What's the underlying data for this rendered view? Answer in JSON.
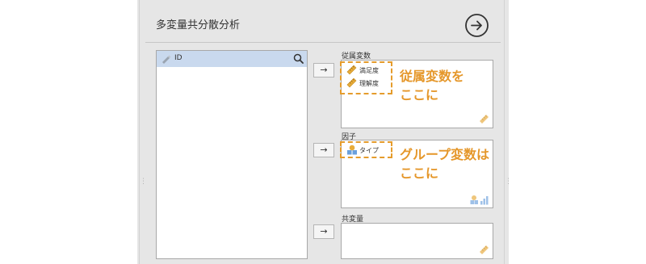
{
  "title": "多変量共分散分析",
  "source": {
    "items": [
      {
        "label": "ID",
        "icon": "pencil-icon"
      }
    ]
  },
  "dependent": {
    "label": "従属変数",
    "items": [
      {
        "label": "満足度",
        "icon": "ruler-icon"
      },
      {
        "label": "理解度",
        "icon": "ruler-icon"
      }
    ]
  },
  "factors": {
    "label": "因子",
    "items": [
      {
        "label": "タイプ",
        "icon": "nominal-icon"
      }
    ]
  },
  "covariates": {
    "label": "共変量",
    "items": []
  },
  "arrow": "→",
  "annotations": {
    "dependent_line1": "従属変数を",
    "dependent_line2": "ここに",
    "factor_line1": "グループ変数は",
    "factor_line2": "ここに"
  },
  "colors": {
    "annotation": "#e5972a",
    "selection": "#c9d9ee",
    "panel": "#e6e6e6"
  }
}
